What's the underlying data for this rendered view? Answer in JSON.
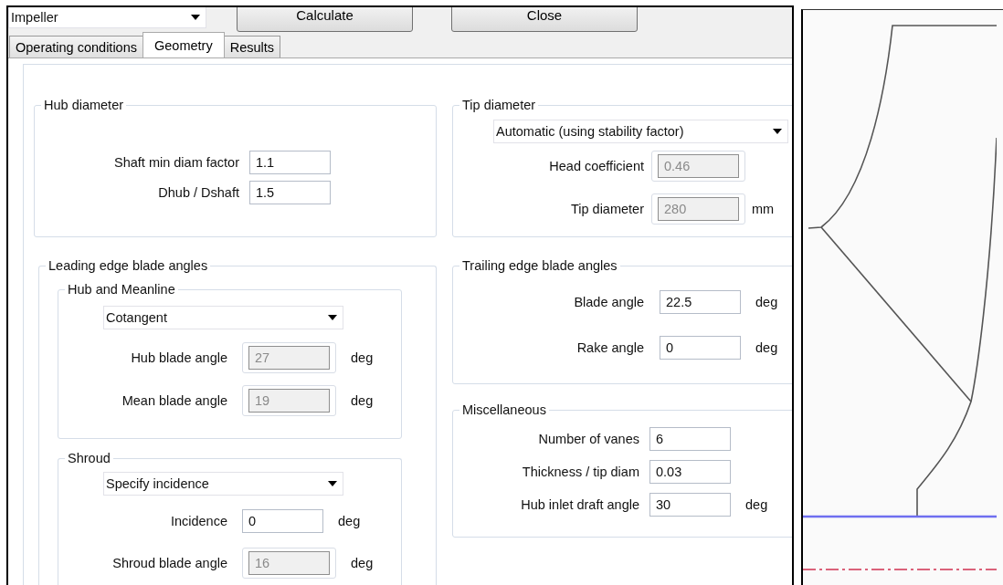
{
  "toolbar": {
    "component": {
      "value": "Impeller"
    },
    "buttons": [
      "Calculate",
      "Close"
    ]
  },
  "tabs": [
    {
      "label": "Operating conditions",
      "selected": false
    },
    {
      "label": "Geometry",
      "selected": true
    },
    {
      "label": "Results",
      "selected": false
    }
  ],
  "hub_diameter": {
    "title": "Hub diameter",
    "fields": [
      {
        "label": "Shaft min diam factor",
        "value": "1.1",
        "disabled": false
      },
      {
        "label": "Dhub / Dshaft",
        "value": "1.5",
        "disabled": false
      }
    ]
  },
  "leading_edge": {
    "title": "Leading edge blade angles",
    "sections": [
      {
        "title": "Hub and Meanline",
        "dropdown": "Cotangent",
        "fields": [
          {
            "label": "Hub blade angle",
            "value": "27",
            "disabled": true,
            "unit": "deg"
          },
          {
            "label": "Mean blade angle",
            "value": "19",
            "disabled": true,
            "unit": "deg"
          }
        ]
      },
      {
        "title": "Shroud",
        "dropdown": "Specify incidence",
        "fields": [
          {
            "label": "Incidence",
            "value": "0",
            "disabled": false,
            "unit": "deg"
          },
          {
            "label": "Shroud blade angle",
            "value": "16",
            "disabled": true,
            "unit": "deg"
          }
        ]
      }
    ]
  },
  "tip_diameter": {
    "title": "Tip diameter",
    "dropdown": "Automatic (using stability factor)",
    "fields": [
      {
        "label": "Head coefficient",
        "value": "0.46",
        "disabled": true
      },
      {
        "label": "Tip diameter",
        "value": "280",
        "disabled": true,
        "unit": "mm"
      }
    ]
  },
  "trailing_edge": {
    "title": "Trailing edge blade angles",
    "fields": [
      {
        "label": "Blade angle",
        "value": "22.5",
        "disabled": false,
        "unit": "deg"
      },
      {
        "label": "Rake angle",
        "value": "0",
        "disabled": false,
        "unit": "deg"
      }
    ]
  },
  "miscellaneous": {
    "title": "Miscellaneous",
    "fields": [
      {
        "label": "Number of vanes",
        "value": "6",
        "disabled": false
      },
      {
        "label": "Thickness / tip diam",
        "value": "0.03",
        "disabled": false
      },
      {
        "label": "Hub inlet draft angle",
        "value": "30",
        "disabled": false,
        "unit": "deg"
      }
    ]
  }
}
